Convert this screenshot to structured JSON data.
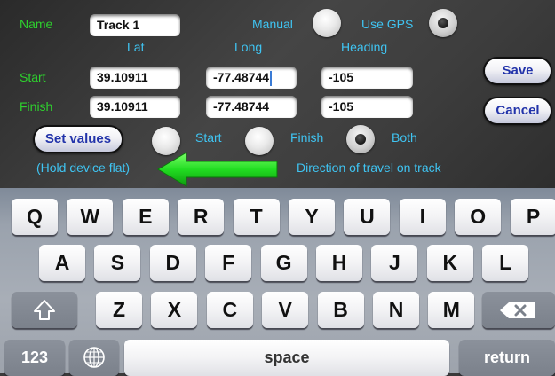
{
  "form": {
    "name_label": "Name",
    "name_value": "Track 1",
    "manual_label": "Manual",
    "use_gps_label": "Use GPS",
    "col_lat": "Lat",
    "col_long": "Long",
    "col_heading": "Heading",
    "start_label": "Start",
    "finish_label": "Finish",
    "start_lat": "39.10911",
    "start_long": "-77.48744",
    "start_heading": "-105",
    "finish_lat": "39.10911",
    "finish_long": "-77.48744",
    "finish_heading": "-105",
    "save_label": "Save",
    "cancel_label": "Cancel",
    "set_values_label": "Set values",
    "opt_start_label": "Start",
    "opt_finish_label": "Finish",
    "opt_both_label": "Both",
    "hold_flat_note": "(Hold device flat)",
    "direction_note": "Direction of travel on track",
    "selected_source": "Use GPS",
    "selected_option": "Both"
  },
  "keyboard": {
    "row1": [
      "Q",
      "W",
      "E",
      "R",
      "T",
      "Y",
      "U",
      "I",
      "O",
      "P"
    ],
    "row2": [
      "A",
      "S",
      "D",
      "F",
      "G",
      "H",
      "J",
      "K",
      "L"
    ],
    "row3": [
      "Z",
      "X",
      "C",
      "V",
      "B",
      "N",
      "M"
    ],
    "numbers_label": "123",
    "space_label": "space",
    "return_label": "return"
  },
  "colors": {
    "label_green": "#2ed12e",
    "label_cyan": "#3fc4f2",
    "arrow_green": "#22dd22",
    "button_text": "#2233aa"
  }
}
